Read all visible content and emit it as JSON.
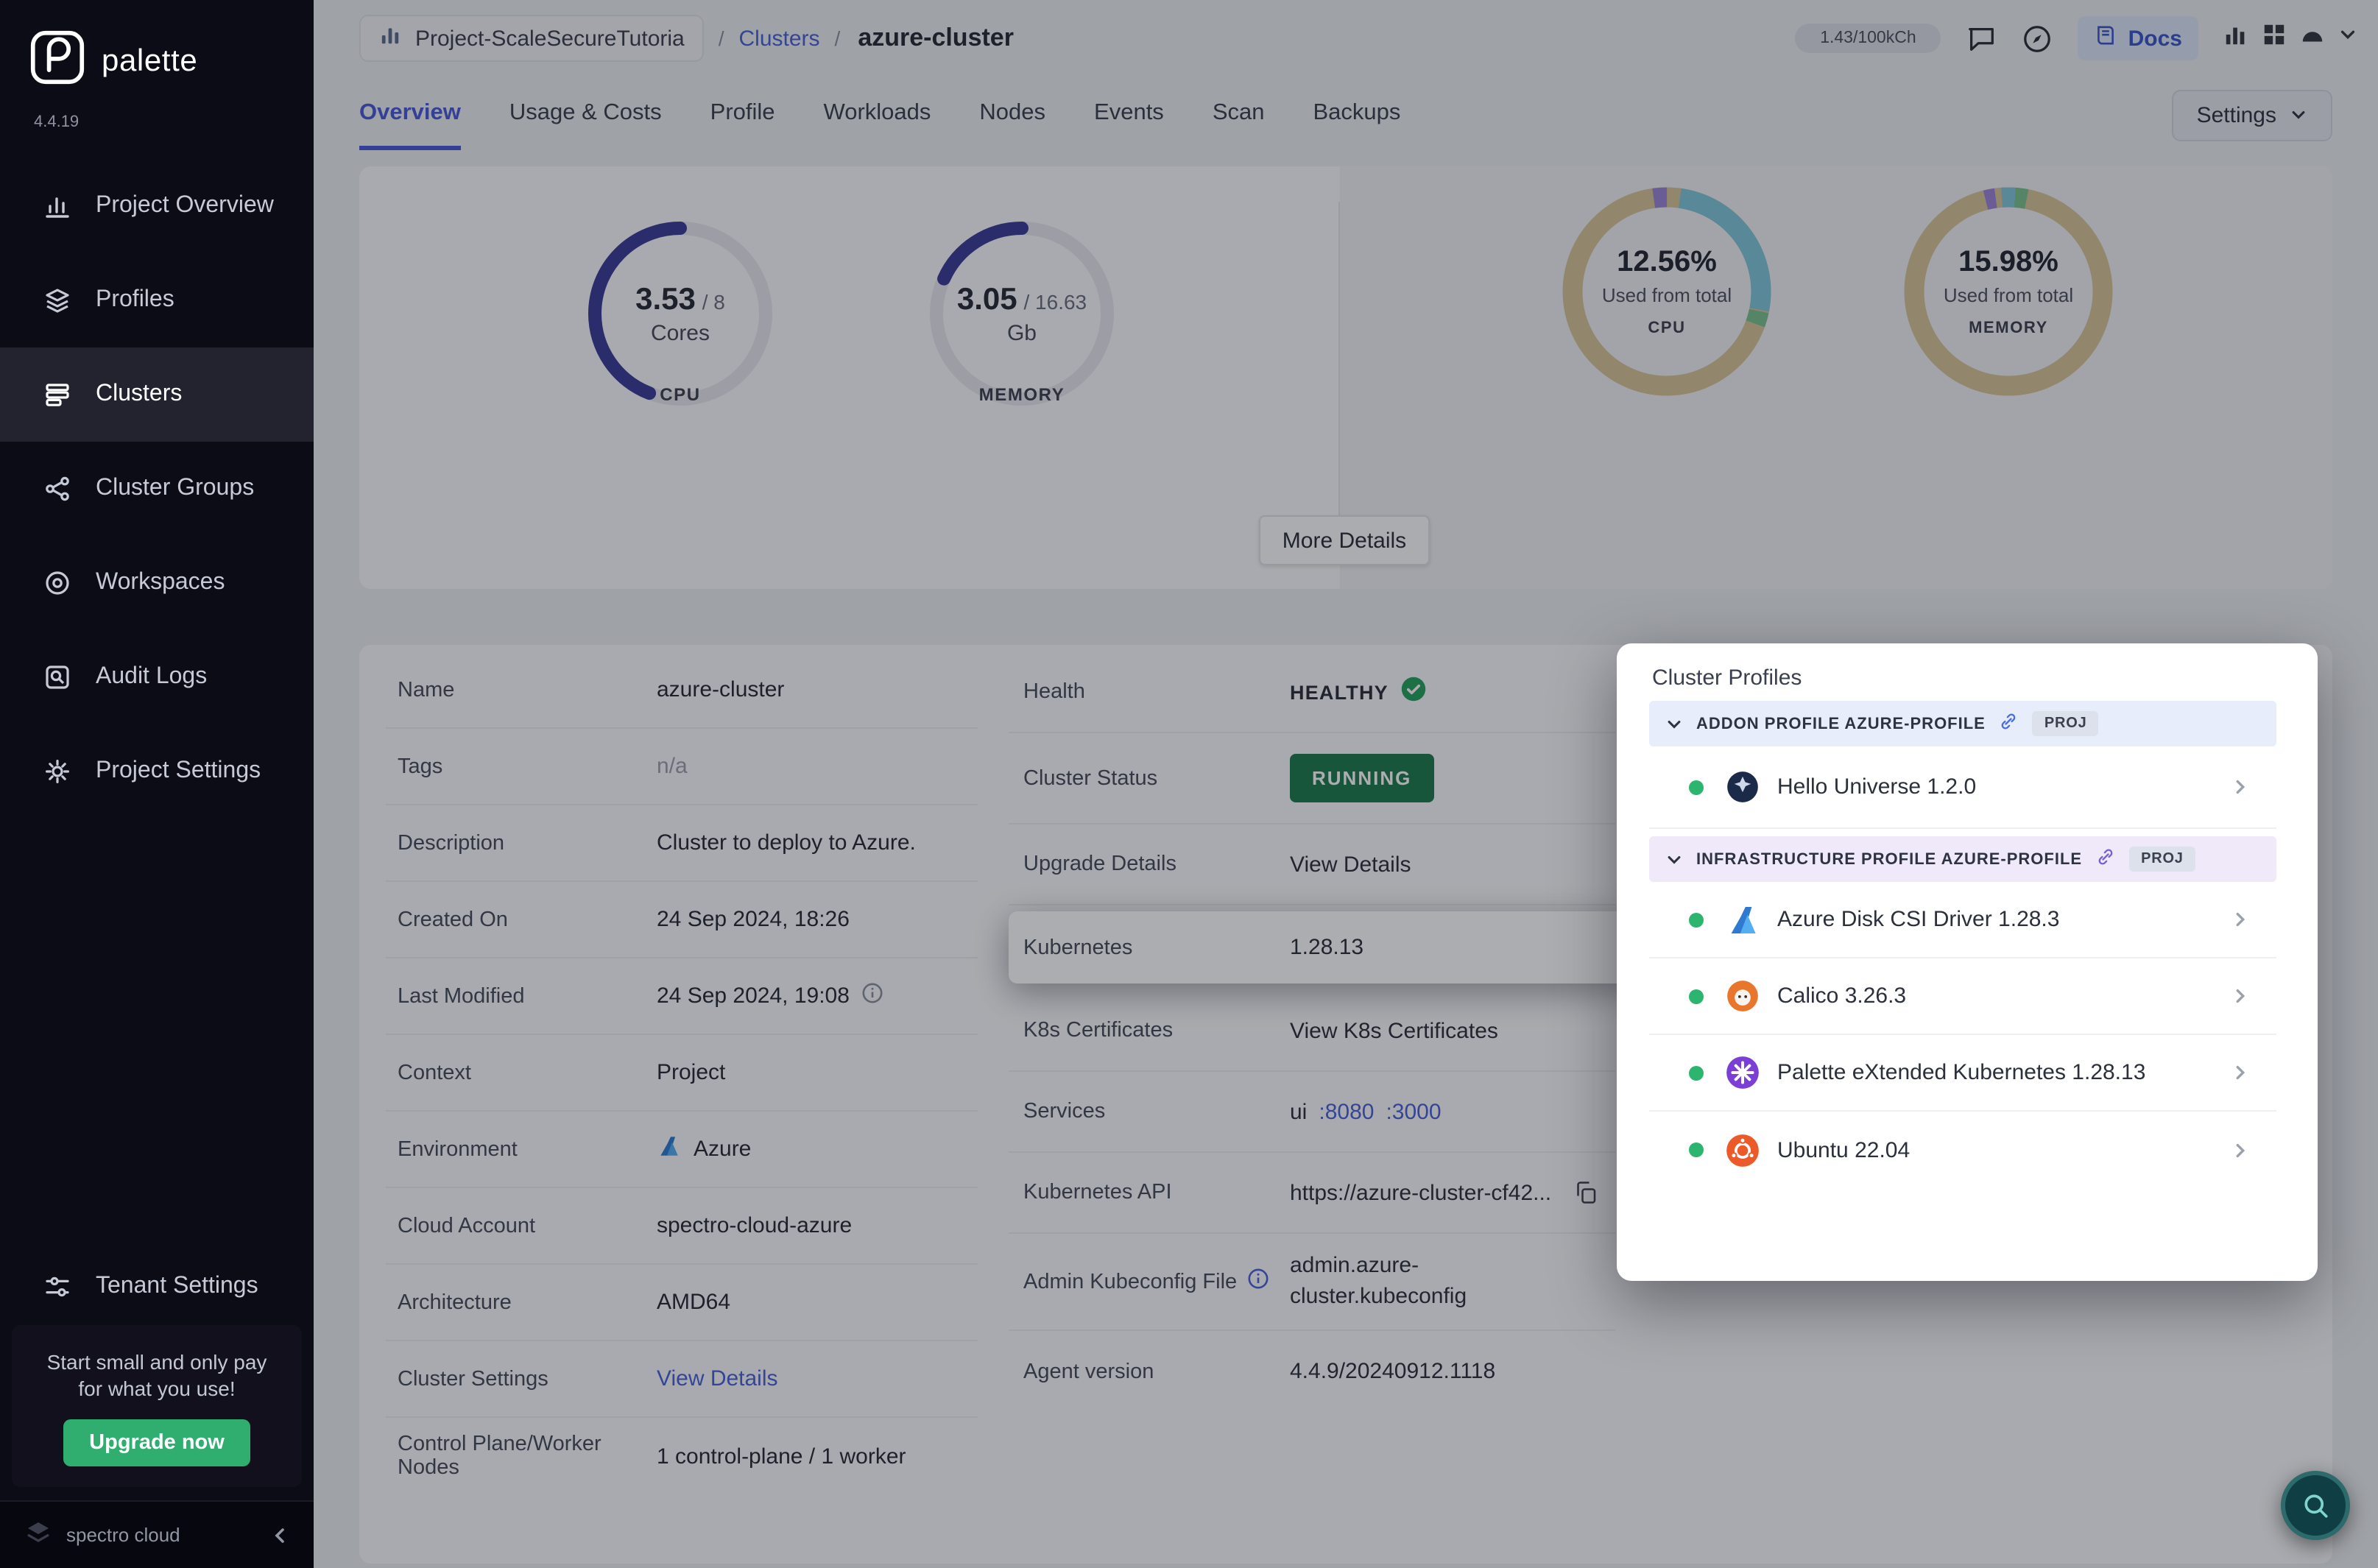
{
  "colors": {
    "accent_blue": "#4a58d8",
    "link_blue": "#4a62d8",
    "running_green": "#1e7b4e",
    "healthy_green": "#27a25f",
    "upgrade_green": "#2fae70",
    "gauge_indigo": "#3c3c96",
    "donut_tan": "#d8c49a",
    "donut_teal": "#82c7db",
    "sidebar_bg": "#0c0c16"
  },
  "sidebar": {
    "brand": "palette",
    "version": "4.4.19",
    "items": [
      {
        "label": "Project Overview"
      },
      {
        "label": "Profiles"
      },
      {
        "label": "Clusters"
      },
      {
        "label": "Cluster Groups"
      },
      {
        "label": "Workspaces"
      },
      {
        "label": "Audit Logs"
      },
      {
        "label": "Project Settings"
      }
    ],
    "tenant_settings_label": "Tenant Settings",
    "promo": {
      "line1": "Start small and only pay",
      "line2": "for what you use!",
      "button": "Upgrade now"
    },
    "footer_brand": "spectro cloud"
  },
  "header": {
    "project_name": "Project-ScaleSecureTutoria",
    "breadcrumb_section": "Clusters",
    "cluster_name": "azure-cluster",
    "credits": "1.43/100kCh",
    "docs_label": "Docs"
  },
  "tabs": {
    "items": [
      {
        "label": "Overview"
      },
      {
        "label": "Usage & Costs"
      },
      {
        "label": "Profile"
      },
      {
        "label": "Workloads"
      },
      {
        "label": "Nodes"
      },
      {
        "label": "Events"
      },
      {
        "label": "Scan"
      },
      {
        "label": "Backups"
      }
    ],
    "active": "Overview",
    "settings_button": "Settings"
  },
  "metrics": {
    "cpu_gauge": {
      "value": "3.53",
      "total": "/ 8",
      "unit": "Cores",
      "label": "CPU"
    },
    "memory_gauge": {
      "value": "3.05",
      "total": "/ 16.63",
      "unit": "Gb",
      "label": "MEMORY"
    },
    "cpu_donut": {
      "percent": "12.56%",
      "caption": "Used from total",
      "label": "CPU"
    },
    "memory_donut": {
      "percent": "15.98%",
      "caption": "Used from total",
      "label": "MEMORY"
    },
    "more_details_button": "More Details"
  },
  "details": {
    "left": [
      {
        "label": "Name",
        "value": "azure-cluster"
      },
      {
        "label": "Tags",
        "value": "n/a"
      },
      {
        "label": "Description",
        "value": "Cluster to deploy to Azure."
      },
      {
        "label": "Created On",
        "value": "24 Sep 2024, 18:26"
      },
      {
        "label": "Last Modified",
        "value": "24 Sep 2024, 19:08"
      },
      {
        "label": "Context",
        "value": "Project"
      },
      {
        "label": "Environment",
        "value": "Azure"
      },
      {
        "label": "Cloud Account",
        "value": "spectro-cloud-azure"
      },
      {
        "label": "Architecture",
        "value": "AMD64"
      },
      {
        "label": "Cluster Settings",
        "value": "View Details"
      },
      {
        "label": "Control Plane/Worker Nodes",
        "value": "1 control-plane / 1 worker"
      }
    ],
    "right": {
      "health_label": "Health",
      "health_value": "HEALTHY",
      "status_label": "Cluster Status",
      "status_value": "RUNNING",
      "upgrade_label": "Upgrade Details",
      "upgrade_value": "View Details",
      "kubernetes_label": "Kubernetes",
      "kubernetes_value": "1.28.13",
      "certificates_label": "K8s Certificates",
      "certificates_value": "View K8s Certificates",
      "services_label": "Services",
      "services_name": "ui",
      "services_port1": ":8080",
      "services_port2": ":3000",
      "api_label": "Kubernetes API",
      "api_value": "https://azure-cluster-cf42...",
      "kubeconfig_label": "Admin Kubeconfig File",
      "kubeconfig_value": "admin.azure-cluster.kubeconfig",
      "agent_label": "Agent version",
      "agent_value": "4.4.9/20240912.1118"
    }
  },
  "cluster_profiles": {
    "title": "Cluster Profiles",
    "sections": [
      {
        "heading": "ADDON PROFILE AZURE-PROFILE",
        "badge": "PROJ",
        "items": [
          {
            "name": "Hello Universe 1.2.0"
          }
        ]
      },
      {
        "heading": "INFRASTRUCTURE PROFILE AZURE-PROFILE",
        "badge": "PROJ",
        "items": [
          {
            "name": "Azure Disk CSI Driver 1.28.3"
          },
          {
            "name": "Calico 3.26.3"
          },
          {
            "name": "Palette eXtended Kubernetes 1.28.13"
          },
          {
            "name": "Ubuntu 22.04"
          }
        ]
      }
    ]
  }
}
